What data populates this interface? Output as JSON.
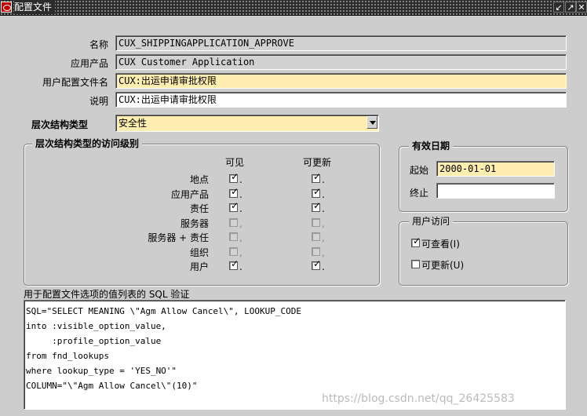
{
  "window": {
    "title": "配置文件",
    "buttons": [
      "↙",
      "↗",
      "✕"
    ]
  },
  "form": {
    "name_label": "名称",
    "name_value": "CUX_SHIPPINGAPPLICATION_APPROVE",
    "app_label": "应用产品",
    "app_value": "CUX Customer Application",
    "user_profile_name_label": "用户配置文件名",
    "user_profile_name_value": "CUX:出运申请审批权限",
    "desc_label": "说明",
    "desc_value": "CUX:出运申请审批权限",
    "hierarchy_type_label": "层次结构类型",
    "hierarchy_type_value": "安全性"
  },
  "access_levels": {
    "title": "层次结构类型的访问级别",
    "col_visible": "可见",
    "col_updatable": "可更新",
    "rows": [
      {
        "label": "地点",
        "visible": true,
        "updatable": true
      },
      {
        "label": "应用产品",
        "visible": true,
        "updatable": true
      },
      {
        "label": "责任",
        "visible": true,
        "updatable": true
      },
      {
        "label": "服务器",
        "visible": false,
        "updatable": false
      },
      {
        "label": "服务器 + 责任",
        "visible": false,
        "updatable": false
      },
      {
        "label": "组织",
        "visible": false,
        "updatable": false
      },
      {
        "label": "用户",
        "visible": true,
        "updatable": true
      }
    ]
  },
  "effective_dates": {
    "title": "有效日期",
    "start_label": "起始",
    "start_value": "2000-01-01",
    "end_label": "终止",
    "end_value": ""
  },
  "user_access": {
    "title": "用户访问",
    "view_label": "可查看(I)",
    "view_checked": true,
    "update_label": "可更新(U)",
    "update_checked": false
  },
  "sql": {
    "label": "用于配置文件选项的值列表的 SQL 验证",
    "lines": [
      "SQL=\"SELECT MEANING \\\"Agm Allow Cancel\\\", LOOKUP_CODE",
      "into :visible_option_value,",
      "     :profile_option_value",
      "from fnd_lookups",
      "where lookup_type = 'YES_NO'\"",
      "COLUMN=\"\\\"Agm Allow Cancel\\\"(10)\""
    ]
  },
  "watermark": "https://blog.csdn.net/qq_26425583"
}
